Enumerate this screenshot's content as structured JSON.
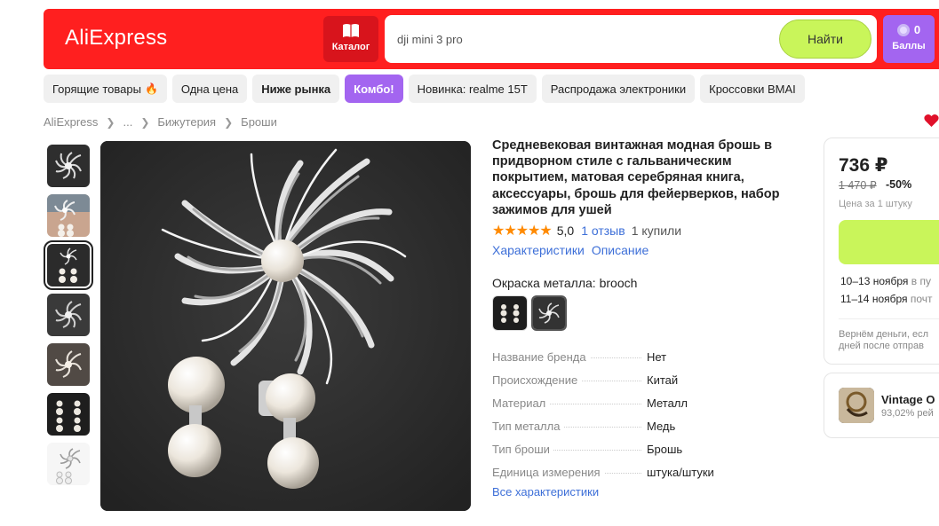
{
  "header": {
    "logo": "AliExpress",
    "catalog_label": "Каталог",
    "search_value": "dji mini 3 pro",
    "search_button": "Найти",
    "points_count": "0",
    "points_label": "Баллы",
    "brand_color": "#ff1f1f",
    "accent_green": "#c9f55a",
    "accent_purple": "#a365f0"
  },
  "chips": [
    {
      "label": "Горящие товары",
      "icon": "fire-icon"
    },
    {
      "label": "Одна цена"
    },
    {
      "label": "Ниже рынка"
    },
    {
      "label": "Комбо!"
    },
    {
      "label": "Новинка: realme 15T"
    },
    {
      "label": "Распродажа электроники"
    },
    {
      "label": "Кроссовки BMAI"
    }
  ],
  "breadcrumb": [
    "AliExpress",
    "...",
    "Бижутерия",
    "Броши"
  ],
  "product": {
    "title": "Средневековая винтажная модная брошь в придворном стиле с гальваническим покрытием, матовая серебряная книга, аксессуары, брошь для фейерверков, набор зажимов для ушей",
    "stars": "★★★★★",
    "rating": "5,0",
    "reviews": "1 отзыв",
    "sold": "1 купили",
    "tab_characteristics": "Характеристики",
    "tab_description": "Описание",
    "color_label": "Окраска металла: brooch",
    "specs": [
      {
        "key": "Название бренда",
        "value": "Нет"
      },
      {
        "key": "Происхождение",
        "value": "Китай"
      },
      {
        "key": "Материал",
        "value": "Металл"
      },
      {
        "key": "Тип металла",
        "value": "Медь"
      },
      {
        "key": "Тип броши",
        "value": "Брошь"
      },
      {
        "key": "Единица измерения",
        "value": "штука/штуки"
      }
    ],
    "all_specs_link": "Все характеристики"
  },
  "buy_panel": {
    "price": "736 ₽",
    "old_price": "1 470 ₽",
    "discount": "-50%",
    "price_note": "Цена за 1 штуку",
    "delivery1_date": "10–13 ноября",
    "delivery1_rest": " в пу",
    "delivery2_date": "11–14 ноября",
    "delivery2_rest": " почт",
    "refund_line1": "Вернём деньги, есл",
    "refund_line2": "дней после отправ"
  },
  "store": {
    "name": "Vintage O",
    "rating": "93,02% рей"
  }
}
